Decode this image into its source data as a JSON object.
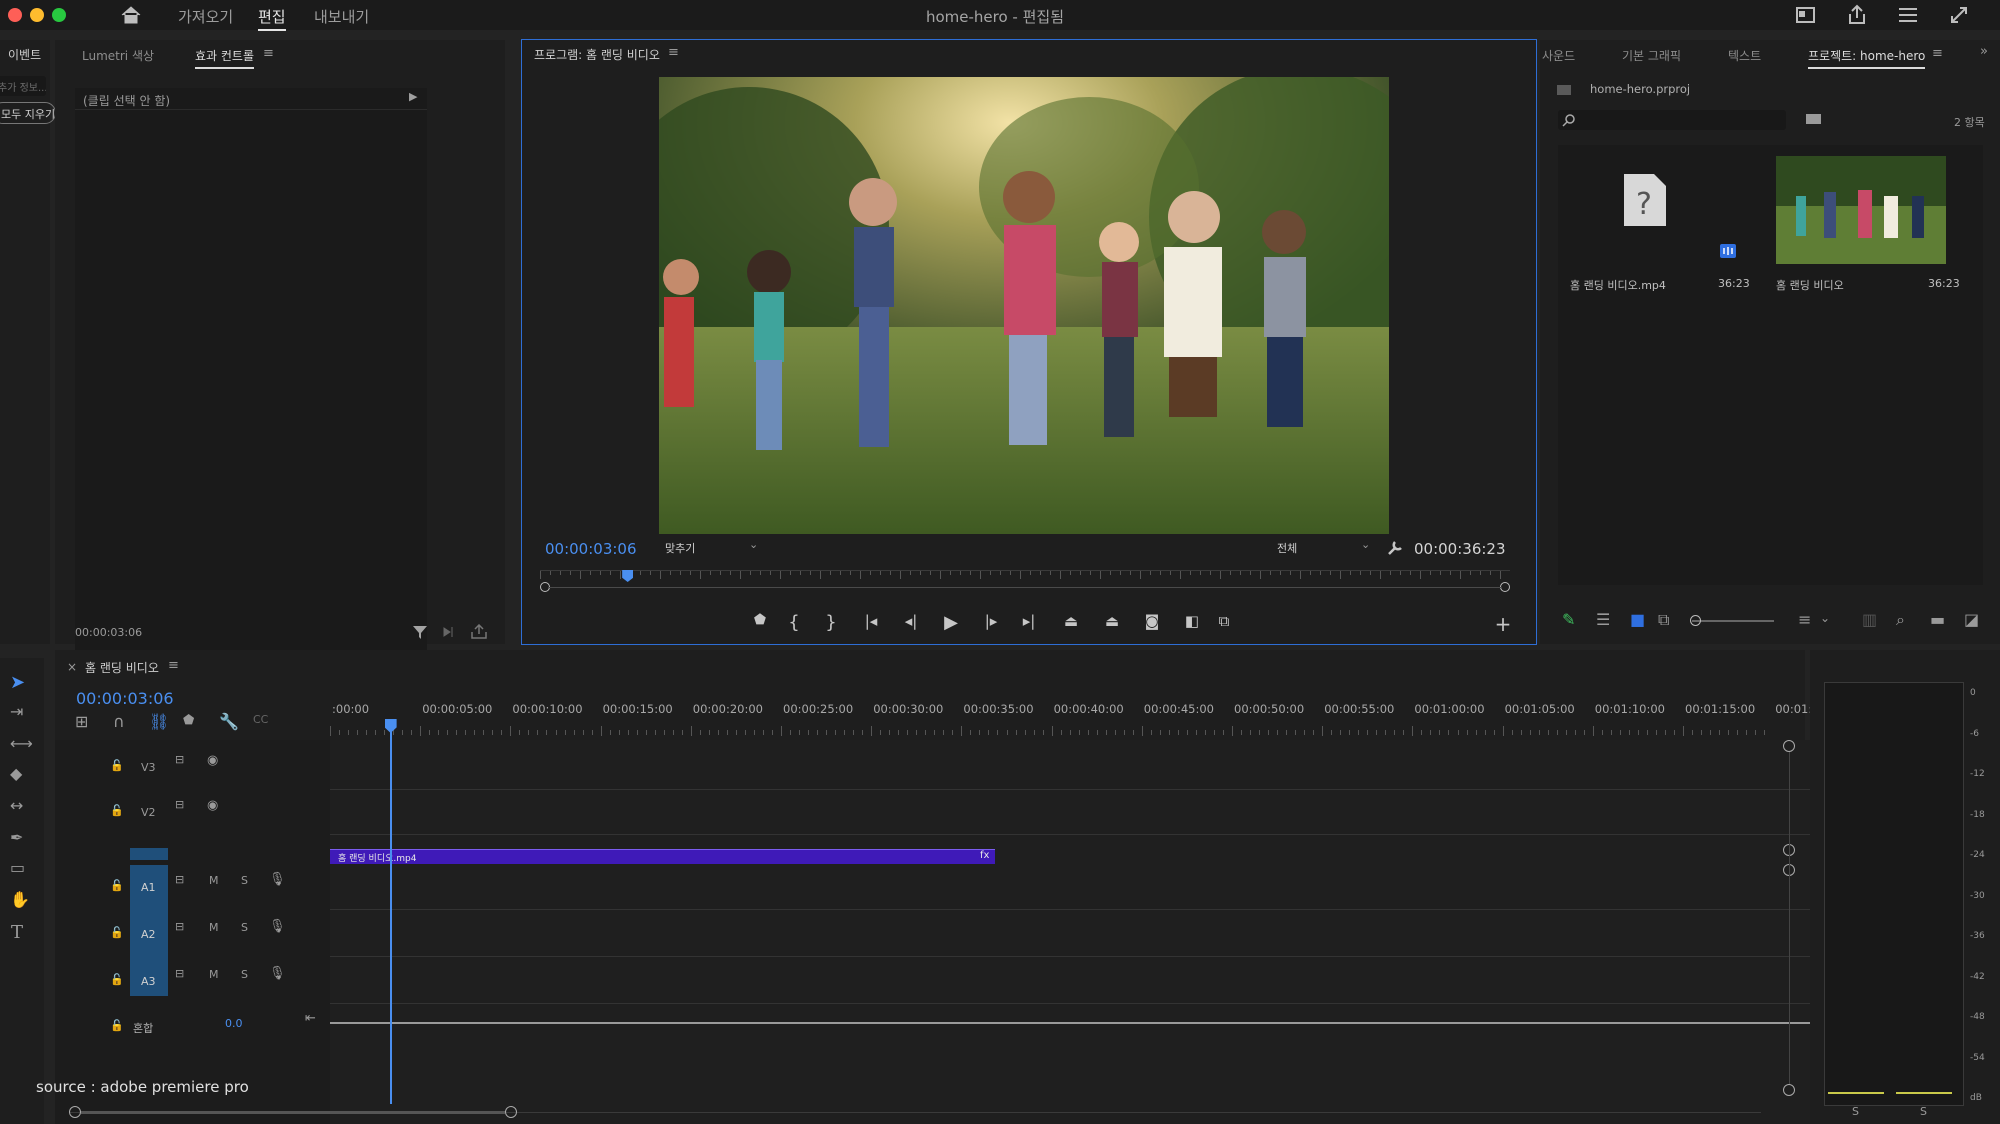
{
  "window": {
    "title": "home-hero - 편집됨"
  },
  "workspace_tabs": [
    {
      "label": "가져오기"
    },
    {
      "label": "편집"
    },
    {
      "label": "내보내기"
    }
  ],
  "left_panel": {
    "side_tab": "이벤트",
    "side_search": "추가 정보...",
    "side_clear": "모두 지우기",
    "tabs": [
      {
        "label": "Lumetri 색상"
      },
      {
        "label": "효과 컨트롤"
      }
    ],
    "no_clip": "(클립 선택 안 함)",
    "timecode": "00:00:03:06"
  },
  "program_monitor": {
    "title": "프로그램: 홈 랜딩 비디오",
    "current_time": "00:00:03:06",
    "zoom_value": "맞추기",
    "quality_value": "전체",
    "duration": "00:00:36:23",
    "playhead_fraction": 0.083
  },
  "right_panel": {
    "tabs": [
      {
        "label": "사운드"
      },
      {
        "label": "기본 그래픽"
      },
      {
        "label": "텍스트"
      },
      {
        "label": "프로젝트: home-hero"
      }
    ],
    "project_file": "home-hero.prproj",
    "item_count": "2 항목",
    "items": [
      {
        "name": "홈 랜딩 비디오.mp4",
        "duration": "36:23"
      },
      {
        "name": "홈 랜딩 비디오",
        "duration": "36:23"
      }
    ]
  },
  "timeline": {
    "sequence_name": "홈 랜딩 비디오",
    "current_time": "00:00:03:06",
    "ruler_labels": [
      ":00:00",
      "00:00:05:00",
      "00:00:10:00",
      "00:00:15:00",
      "00:00:20:00",
      "00:00:25:00",
      "00:00:30:00",
      "00:00:35:00",
      "00:00:40:00",
      "00:00:45:00",
      "00:00:50:00",
      "00:00:55:00",
      "00:01:00:00",
      "00:01:05:00",
      "00:01:10:00",
      "00:01:15:00",
      "00:01:"
    ],
    "video_tracks": [
      {
        "name": "V3"
      },
      {
        "name": "V2"
      }
    ],
    "audio_tracks": [
      {
        "name": "A1",
        "m": "M",
        "s": "S"
      },
      {
        "name": "A2",
        "m": "M",
        "s": "S"
      },
      {
        "name": "A3",
        "m": "M",
        "s": "S"
      }
    ],
    "mix_label": "혼합",
    "mix_value": "0.0",
    "clip_name": "홈 랜딩 비디오.mp4",
    "clip_fx": "fx"
  },
  "audio_meter": {
    "scale": [
      "0",
      "-6",
      "-12",
      "-18",
      "-24",
      "-30",
      "-36",
      "-42",
      "-48",
      "-54",
      "dB"
    ],
    "solo_left": "S",
    "solo_right": "S"
  },
  "watermark": "source : adobe premiere pro",
  "colors": {
    "accent": "#4a8ff0",
    "clip": "#3f1ab8",
    "panel": "#1e1e1e",
    "track_label": "#1f4f7a"
  }
}
